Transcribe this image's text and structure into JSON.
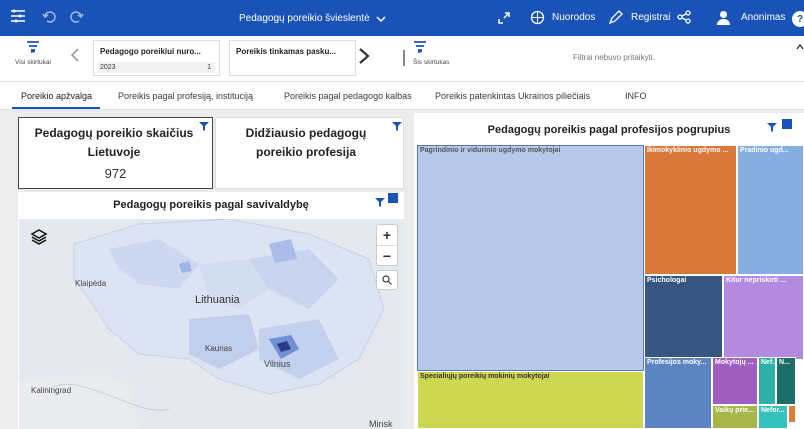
{
  "topbar": {
    "title": "Pedagogų poreikio švieslentė",
    "nav": "Nuorodos",
    "register": "Registrai",
    "user": "Anonimas"
  },
  "filters": {
    "all_label": "Visi skirtukai",
    "dd1_title": "Pedagogo poreikiui nuro...",
    "dd1_value": "2023",
    "dd1_count": "1",
    "dd2_title": "Poreikis tinkamas pasku...",
    "this_label": "Šis skirtukas",
    "none_applied": "Filtrai nebuvo pritaikyti."
  },
  "tabs": [
    {
      "label": "Poreikio apžvalga"
    },
    {
      "label": "Poreikis pagal profesiją, instituciją"
    },
    {
      "label": "Poreikis pagal pedagogo kalbas"
    },
    {
      "label": "Poreikis patenkintas Ukrainos piliečiais"
    },
    {
      "label": "INFO"
    }
  ],
  "kpi1": {
    "title": "Pedagogų poreikio skaičius Lietuvoje",
    "value": "972"
  },
  "kpi2": {
    "title": "Didžiausio pedagogų poreikio profesija"
  },
  "map": {
    "title": "Pedagogų poreikis pagal savivaldybę",
    "labels": {
      "klaipeda": "Klaipėda",
      "lithuania": "Lithuania",
      "kaunas": "Kaunas",
      "vilnius": "Vilnius",
      "kaliningrad": "Kaliningrad",
      "minsk": "Minsk"
    }
  },
  "treemap": {
    "title": "Pedagogų poreikis pagal profesijos pogrupius",
    "cells": [
      {
        "label": "Pagrindinio ir vidurinio ugdymo mokytojai",
        "color": "#b7c9ea",
        "text": "#555"
      },
      {
        "label": "Ikimokyklinio ugdymo ...",
        "color": "#d9783a",
        "text": "#fff"
      },
      {
        "label": "Pradinio ugd...",
        "color": "#86aee0",
        "text": "#fff"
      },
      {
        "label": "Psichologai",
        "color": "#365580",
        "text": "#fff"
      },
      {
        "label": "Kitur nepriskirti ...",
        "color": "#b28be1",
        "text": "#fff"
      },
      {
        "label": "Specialiųjų poreikių mokinių mokytojai",
        "color": "#cdd751",
        "text": "#333"
      },
      {
        "label": "Profesijos moky...",
        "color": "#5d84c2",
        "text": "#fff"
      },
      {
        "label": "Mokytojų ...",
        "color": "#a05ec0",
        "text": "#fff"
      },
      {
        "label": "Nef...",
        "color": "#2eafa8",
        "text": "#fff"
      },
      {
        "label": "N...",
        "color": "#1e6d68",
        "text": "#fff"
      },
      {
        "label": "Vaikų prie...",
        "color": "#a9b74a",
        "text": "#fff"
      },
      {
        "label": "Nefor...",
        "color": "#36c2ba",
        "text": "#fff"
      },
      {
        "label": "",
        "color": "#e07d3a",
        "text": "#fff"
      }
    ]
  }
}
